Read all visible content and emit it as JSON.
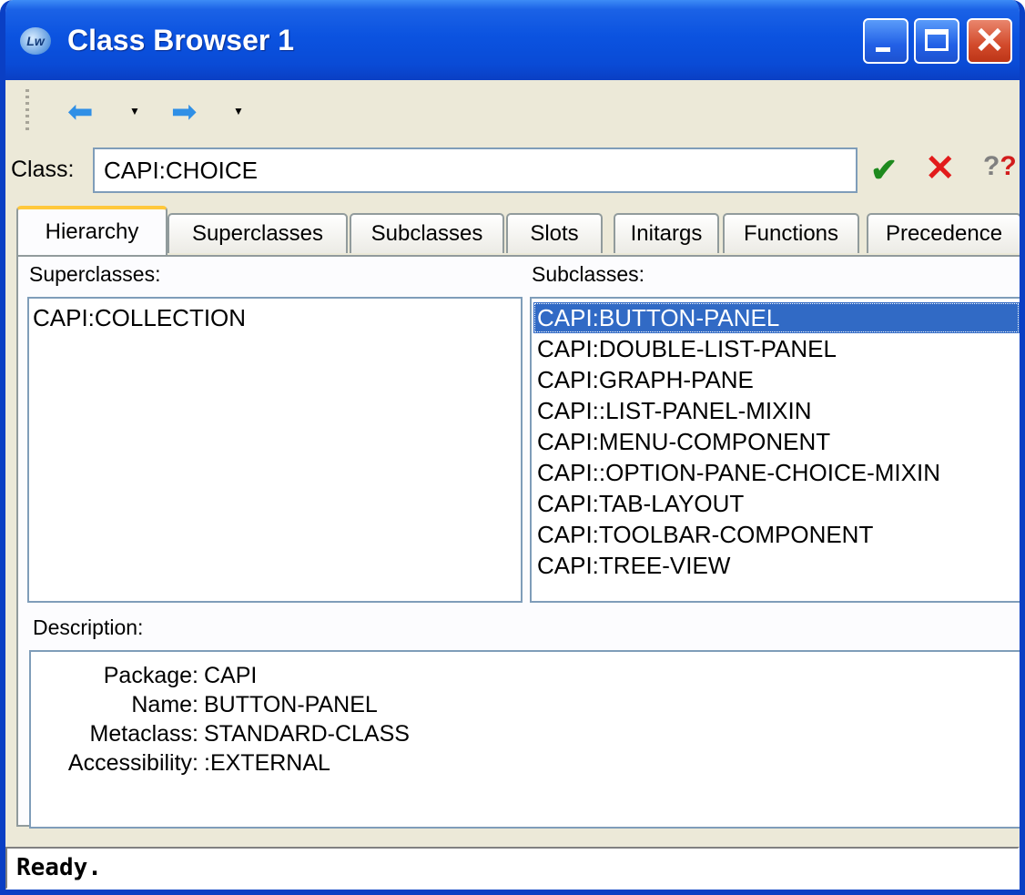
{
  "window": {
    "title": "Class Browser 1",
    "icon_text": "Lw"
  },
  "toolbar": {
    "back_icon": "left-arrow-icon",
    "forward_icon": "right-arrow-icon"
  },
  "class_field": {
    "label": "Class:",
    "value": "CAPI:CHOICE"
  },
  "tabs": [
    {
      "label": "Hierarchy",
      "active": true
    },
    {
      "label": "Superclasses"
    },
    {
      "label": "Subclasses"
    },
    {
      "label": "Slots"
    },
    {
      "label": "Initargs"
    },
    {
      "label": "Functions"
    },
    {
      "label": "Precedence"
    }
  ],
  "superclasses": {
    "label": "Superclasses:",
    "items": [
      "CAPI:COLLECTION"
    ]
  },
  "subclasses": {
    "label": "Subclasses:",
    "selected": "CAPI:BUTTON-PANEL",
    "items": [
      "CAPI:BUTTON-PANEL",
      "CAPI:DOUBLE-LIST-PANEL",
      "CAPI:GRAPH-PANE",
      "CAPI::LIST-PANEL-MIXIN",
      "CAPI:MENU-COMPONENT",
      "CAPI::OPTION-PANE-CHOICE-MIXIN",
      "CAPI:TAB-LAYOUT",
      "CAPI:TOOLBAR-COMPONENT",
      "CAPI:TREE-VIEW"
    ]
  },
  "description": {
    "label": "Description:",
    "rows": [
      {
        "key": "Package:",
        "value": "CAPI"
      },
      {
        "key": "Name:",
        "value": "BUTTON-PANEL"
      },
      {
        "key": "Metaclass:",
        "value": "STANDARD-CLASS"
      },
      {
        "key": "Accessibility:",
        "value": ":EXTERNAL"
      }
    ]
  },
  "status": "Ready."
}
